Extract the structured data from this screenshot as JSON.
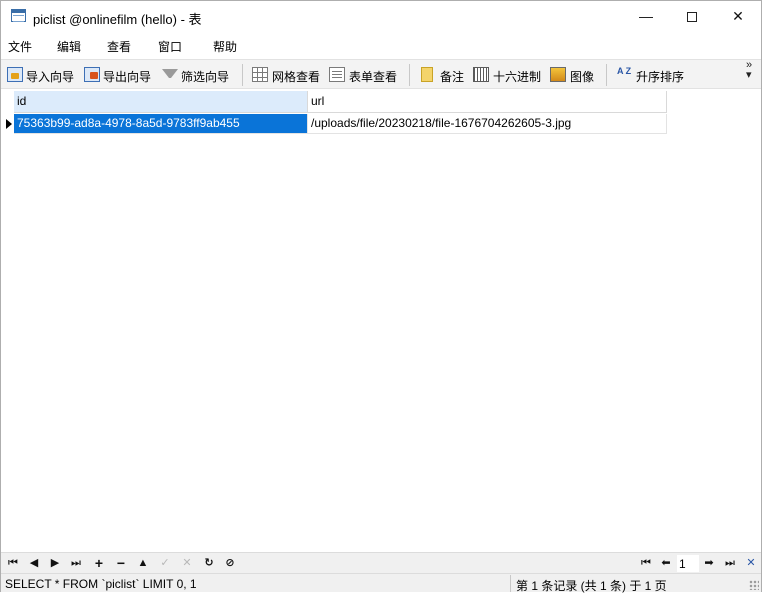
{
  "window": {
    "title": "piclist @onlinefilm (hello) - 表",
    "controls": {
      "minimize": "—",
      "close": "✕"
    }
  },
  "menu": [
    "文件",
    "编辑",
    "查看",
    "窗口",
    "帮助"
  ],
  "toolbar": {
    "import_wizard": "导入向导",
    "export_wizard": "导出向导",
    "filter_wizard": "筛选向导",
    "grid_view": "网格查看",
    "form_view": "表单查看",
    "memo": "备注",
    "hex": "十六进制",
    "image": "图像",
    "sort_asc": "升序排序",
    "sort_icon_text": "A Z",
    "more": "»"
  },
  "table": {
    "columns": [
      "id",
      "url"
    ],
    "rows": [
      [
        "75363b99-ad8a-4978-8a5d-9783ff9ab455",
        "/uploads/file/20230218/file-1676704262605-3.jpg"
      ]
    ]
  },
  "navigation": {
    "current_page": "1"
  },
  "status": {
    "sql": "SELECT * FROM `piclist` LIMIT 0, 1",
    "record_info": "第 1 条记录 (共 1 条) 于 1 页"
  }
}
